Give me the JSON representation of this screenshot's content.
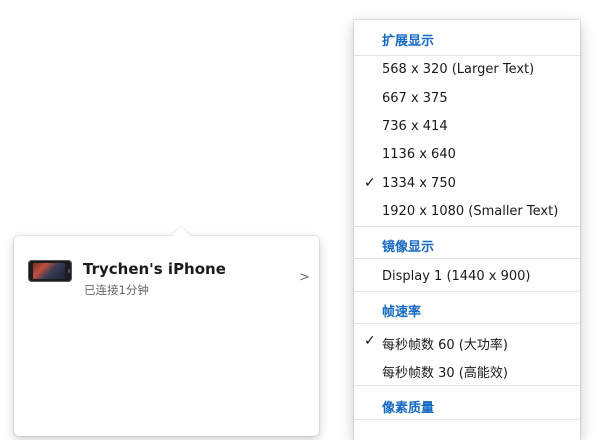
{
  "device_panel": {
    "device_name": "Trychen's iPhone",
    "device_status": "已连接1分钟",
    "chevron_glyph": ">"
  },
  "menu": {
    "sections": [
      {
        "header": "扩展显示",
        "items": [
          {
            "label": "568 x 320 (Larger Text)",
            "checked": false
          },
          {
            "label": "667 x 375",
            "checked": false
          },
          {
            "label": "736 x 414",
            "checked": false
          },
          {
            "label": "1136 x 640",
            "checked": false
          },
          {
            "label": "1334 x 750",
            "checked": true
          },
          {
            "label": "1920 x 1080 (Smaller Text)",
            "checked": false
          }
        ]
      },
      {
        "header": "镜像显示",
        "items": [
          {
            "label": "Display 1 (1440 x 900)",
            "checked": false
          }
        ]
      },
      {
        "header": "帧速率",
        "items": [
          {
            "label": "每秒帧数 60 (大功率)",
            "checked": true
          },
          {
            "label": "每秒帧数 30 (高能效)",
            "checked": false
          }
        ]
      },
      {
        "header": "像素质量",
        "items": []
      }
    ],
    "check_glyph": "✓"
  },
  "colors": {
    "section_header": "#1669c2",
    "menu_text": "#1a1a1a",
    "status_text": "#666666"
  }
}
